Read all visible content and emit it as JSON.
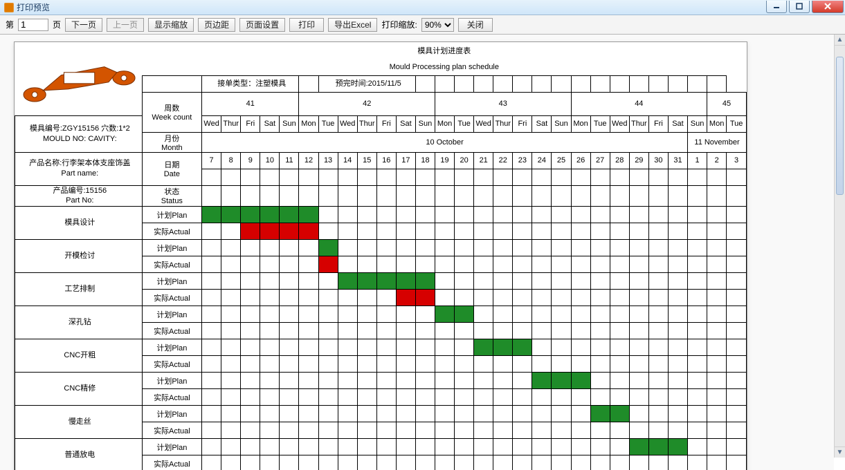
{
  "window": {
    "title": "打印预览"
  },
  "toolbar": {
    "page_label_prefix": "第",
    "page_value": "1",
    "page_label_suffix": "页",
    "prev": "上一页",
    "next": "下一页",
    "show_zoom": "显示缩放",
    "margins": "页边距",
    "page_setup": "页面设置",
    "print": "打印",
    "export_excel": "导出Excel",
    "print_zoom_label": "打印缩放:",
    "zoom_value": "90%",
    "close": "关闭"
  },
  "titles": {
    "cn": "模具计划进度表",
    "en": "Mould Processing plan schedule"
  },
  "info": {
    "order_type": "接单类型：注塑模具",
    "finish_time": "预完时间:2015/11/5",
    "mould_no": "模具编号:ZGY15156     穴数:1*2",
    "mould_no_en": "MOULD NO:         CAVITY:",
    "part_name": "产品名称:行李架本体支座饰盖",
    "part_name_en": "Part name:",
    "part_no": "产品编号:15156",
    "part_no_en": "Part No:"
  },
  "labels": {
    "week_cn": "周数",
    "week_en": "Week count",
    "month_cn": "月份",
    "month_en": "Month",
    "date_cn": "日期",
    "date_en": "Date",
    "status_cn": "状态",
    "status_en": "Status",
    "plan": "计划Plan",
    "actual": "实际Actual",
    "oct": "10 October",
    "nov": "11 November"
  },
  "weeks": [
    "41",
    "42",
    "43",
    "44",
    "45"
  ],
  "days_of_week_41": [
    "Wed",
    "Thur",
    "Fri",
    "Sat",
    "Sun"
  ],
  "days_of_week_full": [
    "Mon",
    "Tue",
    "Wed",
    "Thur",
    "Fri",
    "Sat",
    "Sun"
  ],
  "days_of_week_45": [
    "Mon",
    "Tue"
  ],
  "dates": [
    "7",
    "8",
    "9",
    "10",
    "11",
    "12",
    "13",
    "14",
    "15",
    "16",
    "17",
    "18",
    "19",
    "20",
    "21",
    "22",
    "23",
    "24",
    "25",
    "26",
    "27",
    "28",
    "29",
    "30",
    "31",
    "1",
    "2",
    "3"
  ],
  "tasks": [
    {
      "name": "模具设计",
      "plan": [
        0,
        6
      ],
      "actual": [
        2,
        6
      ]
    },
    {
      "name": "开模检讨",
      "plan": [
        6,
        7
      ],
      "actual": [
        6,
        7
      ]
    },
    {
      "name": "工艺排制",
      "plan": [
        7,
        12
      ],
      "actual": [
        10,
        12
      ]
    },
    {
      "name": "深孔钻",
      "plan": [
        12,
        14
      ],
      "actual": null
    },
    {
      "name": "CNC开粗",
      "plan": [
        14,
        17
      ],
      "actual": null
    },
    {
      "name": "CNC精修",
      "plan": [
        17,
        20
      ],
      "actual": null
    },
    {
      "name": "慢走丝",
      "plan": [
        20,
        22
      ],
      "actual": null
    },
    {
      "name": "普通放电",
      "plan": [
        22,
        25
      ],
      "actual": null
    }
  ],
  "chart_data": {
    "type": "table",
    "title": "Mould Processing plan schedule",
    "date_range_start": "2015-10-07",
    "date_range_end": "2015-11-03",
    "series": [
      {
        "name": "模具设计 Plan",
        "start": "2015-10-07",
        "end": "2015-10-12"
      },
      {
        "name": "模具设计 Actual",
        "start": "2015-10-09",
        "end": "2015-10-12"
      },
      {
        "name": "开模检讨 Plan",
        "start": "2015-10-13",
        "end": "2015-10-13"
      },
      {
        "name": "开模检讨 Actual",
        "start": "2015-10-13",
        "end": "2015-10-13"
      },
      {
        "name": "工艺排制 Plan",
        "start": "2015-10-14",
        "end": "2015-10-18"
      },
      {
        "name": "工艺排制 Actual",
        "start": "2015-10-17",
        "end": "2015-10-18"
      },
      {
        "name": "深孔钻 Plan",
        "start": "2015-10-19",
        "end": "2015-10-20"
      },
      {
        "name": "CNC开粗 Plan",
        "start": "2015-10-21",
        "end": "2015-10-23"
      },
      {
        "name": "CNC精修 Plan",
        "start": "2015-10-24",
        "end": "2015-10-26"
      },
      {
        "name": "慢走丝 Plan",
        "start": "2015-10-27",
        "end": "2015-10-28"
      },
      {
        "name": "普通放电 Plan",
        "start": "2015-10-29",
        "end": "2015-10-31"
      }
    ]
  }
}
